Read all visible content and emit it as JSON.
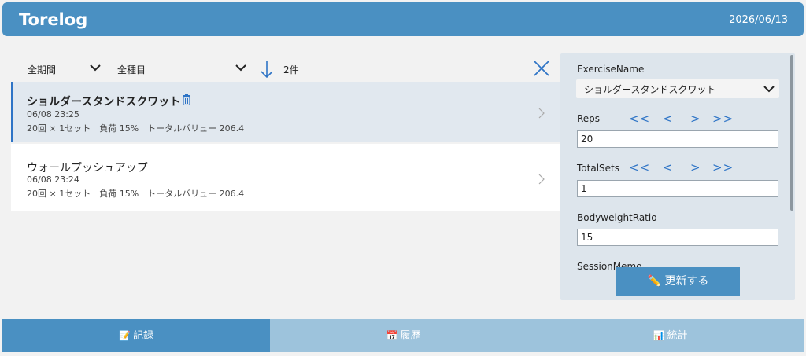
{
  "header": {
    "title": "Torelog",
    "date": "2026/06/13"
  },
  "filters": {
    "period": "全期間",
    "category": "全種目",
    "count": "2件"
  },
  "list": [
    {
      "name": "ショルダースタンドスクワット",
      "time": "06/08 23:25",
      "detail": "20回 × 1セット　負荷 15%　トータルバリュー 206.4",
      "selected": true
    },
    {
      "name": "ウォールプッシュアップ",
      "time": "06/08 23:24",
      "detail": "20回 × 1セット　負荷 15%　トータルバリュー 206.4",
      "selected": false
    }
  ],
  "panel": {
    "exercise_label": "ExerciseName",
    "exercise_value": "ショルダースタンドスクワット",
    "reps_label": "Reps",
    "reps_value": "20",
    "sets_label": "TotalSets",
    "sets_value": "1",
    "bw_label": "BodyweightRatio",
    "bw_value": "15",
    "memo_label": "SessionMemo",
    "stepper": {
      "dec_big": "<<",
      "dec": "<",
      "inc": ">",
      "inc_big": ">>"
    },
    "update_button": "更新する",
    "update_icon": "pencil-icon"
  },
  "tabs": [
    {
      "label": "記録",
      "icon": "memo-icon",
      "active": true
    },
    {
      "label": "履歴",
      "icon": "calendar-icon",
      "active": false
    },
    {
      "label": "統計",
      "icon": "bar-chart-icon",
      "active": false
    }
  ],
  "colors": {
    "accent": "#4a90c2",
    "link": "#2e74c6",
    "tab_inactive": "#9dc3dc"
  }
}
